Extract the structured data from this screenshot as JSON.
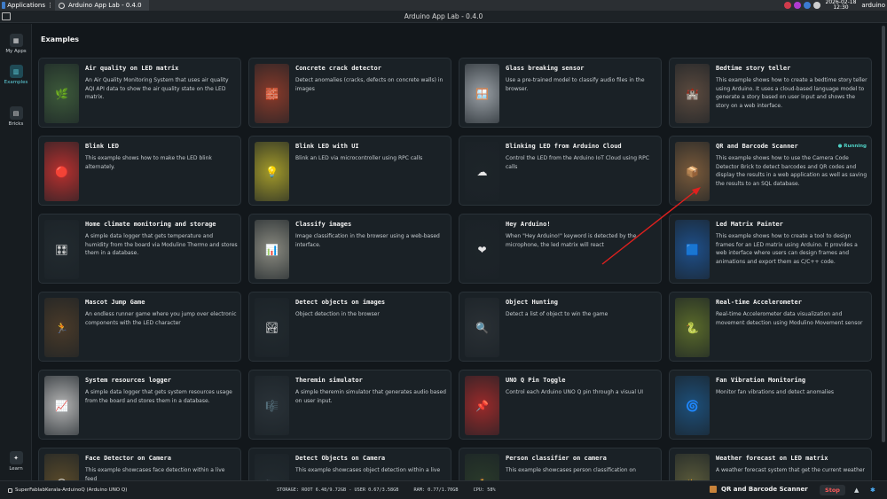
{
  "os": {
    "applications_label": "Applications",
    "task_label": "Arduino App Lab - 0.4.0",
    "date": "2026-02-18",
    "time": "12:30",
    "user": "arduino",
    "tray_colors": [
      "#d03b4b",
      "#b03bd0",
      "#3b7bd0",
      "#cfcfcf"
    ]
  },
  "window": {
    "title": "Arduino App Lab - 0.4.0"
  },
  "sidebar": {
    "items": [
      {
        "label": "My Apps",
        "icon": "grid-icon",
        "glyph": "▦",
        "active": false
      },
      {
        "label": "Examples",
        "icon": "examples-icon",
        "glyph": "▥",
        "active": true
      },
      {
        "label": "Bricks",
        "icon": "bricks-icon",
        "glyph": "▤",
        "active": false
      },
      {
        "label": "Learn",
        "icon": "learn-icon",
        "glyph": "✦",
        "active": false
      }
    ]
  },
  "main": {
    "heading": "Examples",
    "cards": [
      {
        "title": "Air quality on LED matrix",
        "desc": "An Air Quality Monitoring System that uses air quality AQI API data to show the air quality state on the LED matrix.",
        "thumb_color": "#3d5a3a",
        "glyph": "🌿",
        "icon": "leaf-icon",
        "badge": ""
      },
      {
        "title": "Concrete crack detector",
        "desc": "Detect anomalies (cracks, defects on concrete walls) in images",
        "thumb_color": "#8a3a2a",
        "glyph": "🧱",
        "icon": "brick-icon",
        "badge": ""
      },
      {
        "title": "Glass breaking sensor",
        "desc": "Use a pre-trained model to classify audio files in the browser.",
        "thumb_color": "#9aa0a6",
        "glyph": "🪟",
        "icon": "window-icon",
        "badge": ""
      },
      {
        "title": "Bedtime story teller",
        "desc": "This example shows how to create a bedtime story teller using Arduino. It uses a cloud-based language model to generate a story based on user input and shows the story on a web interface.",
        "thumb_color": "#5c4a3e",
        "glyph": "🏰",
        "icon": "castle-icon",
        "badge": ""
      },
      {
        "title": "Blink LED",
        "desc": "This example shows how to make the LED blink alternately.",
        "thumb_color": "#b8302e",
        "glyph": "🔴",
        "icon": "red-dot-icon",
        "badge": ""
      },
      {
        "title": "Blink LED with UI",
        "desc": "Blink an LED via microcontroller using RPC calls",
        "thumb_color": "#a39a2a",
        "glyph": "💡",
        "icon": "bulb-icon",
        "badge": ""
      },
      {
        "title": "Blinking LED from Arduino Cloud",
        "desc": "Control the LED from the Arduino IoT Cloud using RPC calls",
        "thumb_color": "#1d2429",
        "glyph": "☁",
        "icon": "cloud-icon",
        "badge": ""
      },
      {
        "title": "QR and Barcode Scanner",
        "desc": "This example shows how to use the Camera Code Detector Brick to detect barcodes and QR codes and display the results in a web application as well as saving the results to an SQL database.",
        "thumb_color": "#7a5a3a",
        "glyph": "📦",
        "icon": "package-icon",
        "badge": "● Running"
      },
      {
        "title": "Home climate monitoring and storage",
        "desc": "A simple data logger that gets temperature and humidity from the board via Modulino Thermo and stores them in a database.",
        "thumb_color": "#222a2f",
        "glyph": "🎛",
        "icon": "dice-icon",
        "badge": ""
      },
      {
        "title": "Classify images",
        "desc": "Image classification in the browser using a web-based interface.",
        "thumb_color": "#8a8a80",
        "glyph": "📊",
        "icon": "chart-icon",
        "badge": ""
      },
      {
        "title": "Hey Arduino!",
        "desc": "When \"Hey Arduino!\" keyword is detected by the microphone, the led matrix will react",
        "thumb_color": "#1d2429",
        "glyph": "❤",
        "icon": "heart-icon",
        "badge": ""
      },
      {
        "title": "Led Matrix Painter",
        "desc": "This example shows how to create a tool to design frames for an LED matrix using Arduino. It provides a web interface where users can design frames and animations and export them as C/C++ code.",
        "thumb_color": "#1e4f8a",
        "glyph": "🟦",
        "icon": "square-icon",
        "badge": ""
      },
      {
        "title": "Mascot Jump Game",
        "desc": "An endless runner game where you jump over electronic components with the LED character",
        "thumb_color": "#4a3a28",
        "glyph": "🏃",
        "icon": "runner-icon",
        "badge": ""
      },
      {
        "title": "Detect objects on images",
        "desc": "Object detection in the browser",
        "thumb_color": "#222a2f",
        "glyph": "🏞",
        "icon": "landscape-icon",
        "badge": ""
      },
      {
        "title": "Object Hunting",
        "desc": "Detect a list of object to win the game",
        "thumb_color": "#2a3035",
        "glyph": "🔍",
        "icon": "magnifier-icon",
        "badge": ""
      },
      {
        "title": "Real-time Accelerometer",
        "desc": "Real-time Accelerometer data visualization and movement detection using Modulino Movement sensor",
        "thumb_color": "#5a6a2a",
        "glyph": "🐍",
        "icon": "snake-icon",
        "badge": ""
      },
      {
        "title": "System resources logger",
        "desc": "A simple data logger that gets system resources usage from the board and stores them in a database.",
        "thumb_color": "#b4b4b4",
        "glyph": "📈",
        "icon": "line-chart-icon",
        "badge": ""
      },
      {
        "title": "Theremin simulator",
        "desc": "A simple theremin simulator that generates audio based on user input.",
        "thumb_color": "#2a3238",
        "glyph": "🎼",
        "icon": "music-icon",
        "badge": ""
      },
      {
        "title": "UNO Q Pin Toggle",
        "desc": "Control each Arduino UNO Q pin through a visual UI",
        "thumb_color": "#9a2a2a",
        "glyph": "📌",
        "icon": "pin-icon",
        "badge": ""
      },
      {
        "title": "Fan Vibration Monitoring",
        "desc": "Monitor fan vibrations and detect anomalies",
        "thumb_color": "#1d4f7a",
        "glyph": "🌀",
        "icon": "spiral-icon",
        "badge": ""
      },
      {
        "title": "Face Detector on Camera",
        "desc": "This example showcases face detection within a live feed",
        "thumb_color": "#5a4a2a",
        "glyph": "😀",
        "icon": "face-icon",
        "badge": ""
      },
      {
        "title": "Detect Objects on Camera",
        "desc": "This example showcases object detection within a live",
        "thumb_color": "#222a2f",
        "glyph": "📷",
        "icon": "camera-icon",
        "badge": ""
      },
      {
        "title": "Person classifier on camera",
        "desc": "This example showcases person classification on",
        "thumb_color": "#2a3a2a",
        "glyph": "🧍",
        "icon": "person-icon",
        "badge": ""
      },
      {
        "title": "Weather forecast on LED matrix",
        "desc": "A weather forecast system that get the current weather",
        "thumb_color": "#5a5a3a",
        "glyph": "⛅",
        "icon": "weather-icon",
        "badge": ""
      }
    ]
  },
  "statusbar": {
    "board": "SuperFablabKerala-ArduinoQ (Arduino UNO Q)",
    "storage": "STORAGE: ROOT 6.48/9.72GB - USER 0.67/3.58GB",
    "ram": "RAM: 0.77/1.70GB",
    "cpu": "CPU: 58%",
    "running_app": "QR and Barcode Scanner",
    "stop_label": "Stop"
  }
}
